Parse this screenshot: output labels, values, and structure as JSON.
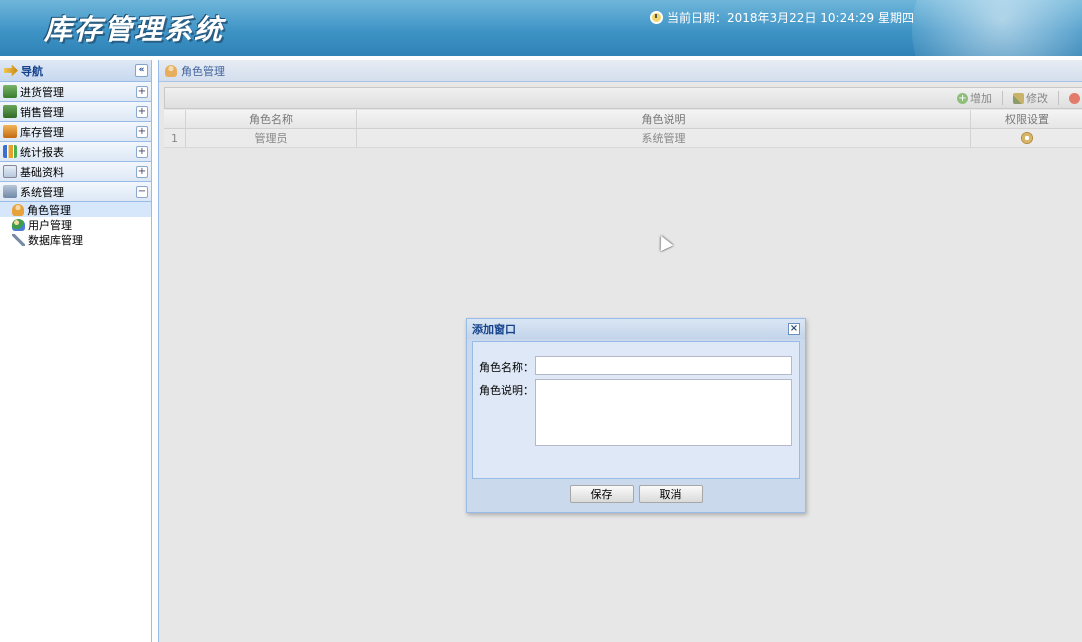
{
  "header": {
    "title": "库存管理系统",
    "date_text": "当前日期：2018年3月22日 10:24:29 星期四"
  },
  "sidebar": {
    "title": "导航",
    "collapse_glyph": "«",
    "sections": [
      {
        "label": "进货管理",
        "toggle": "+"
      },
      {
        "label": "销售管理",
        "toggle": "+"
      },
      {
        "label": "库存管理",
        "toggle": "+"
      },
      {
        "label": "统计报表",
        "toggle": "+"
      },
      {
        "label": "基础资料",
        "toggle": "+"
      },
      {
        "label": "系统管理",
        "toggle": "−"
      }
    ],
    "sub_items": [
      {
        "label": "角色管理",
        "active": true
      },
      {
        "label": "用户管理",
        "active": false
      },
      {
        "label": "数据库管理",
        "active": false
      }
    ]
  },
  "main": {
    "tab_title": "角色管理",
    "toolbar": {
      "add_label": "增加",
      "edit_label": "修改"
    },
    "grid": {
      "columns": [
        "角色名称",
        "角色说明",
        "权限设置"
      ],
      "rows": [
        {
          "index": "1",
          "name": "管理员",
          "desc": "系统管理"
        }
      ]
    }
  },
  "dialog": {
    "title": "添加窗口",
    "close_glyph": "×",
    "name_label": "角色名称：",
    "desc_label": "角色说明：",
    "name_value": "",
    "desc_value": "",
    "save_label": "保存",
    "cancel_label": "取消"
  }
}
